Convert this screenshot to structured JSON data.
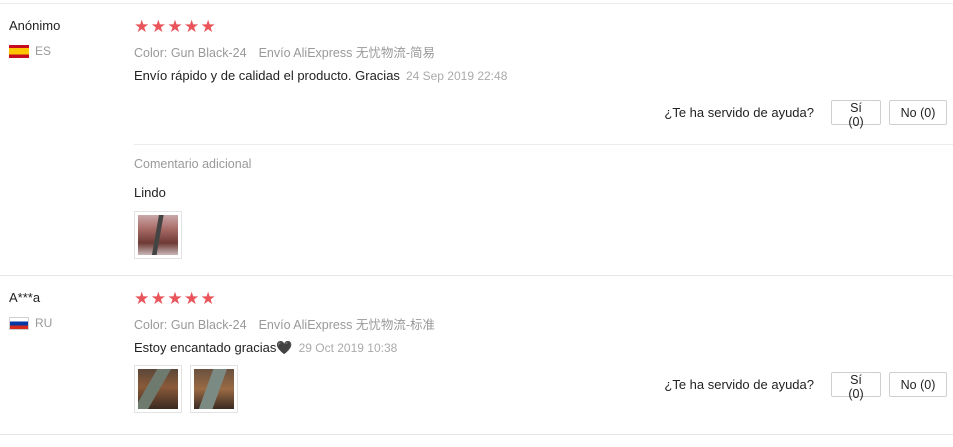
{
  "helpful_question": "¿Te ha servido de ayuda?",
  "reviews": [
    {
      "user": "Anónimo",
      "country": "ES",
      "rating": 5,
      "color_option": "Color: Gun Black-24",
      "shipping": "Envío AliExpress 无忧物流-简易",
      "text": "Envío rápido y de calidad el producto. Gracias",
      "date": "24 Sep 2019 22:48",
      "yes_label": "Sí (0)",
      "no_label": "No (0)",
      "additional_label": "Comentario adicional",
      "additional_text": "Lindo",
      "photo_count": 1
    },
    {
      "user": "A***a",
      "country": "RU",
      "rating": 5,
      "color_option": "Color: Gun Black-24",
      "shipping": "Envío AliExpress 无忧物流-标准",
      "text": "Estoy encantado gracias🖤",
      "date": "29 Oct 2019 10:38",
      "yes_label": "Sí (0)",
      "no_label": "No (0)",
      "photo_count": 2
    }
  ],
  "colors": {
    "star": "#e9535a",
    "muted_text": "#999999"
  },
  "icons": {
    "star": "star-icon",
    "flag_es": "spain-flag-icon",
    "flag_ru": "russia-flag-icon"
  }
}
